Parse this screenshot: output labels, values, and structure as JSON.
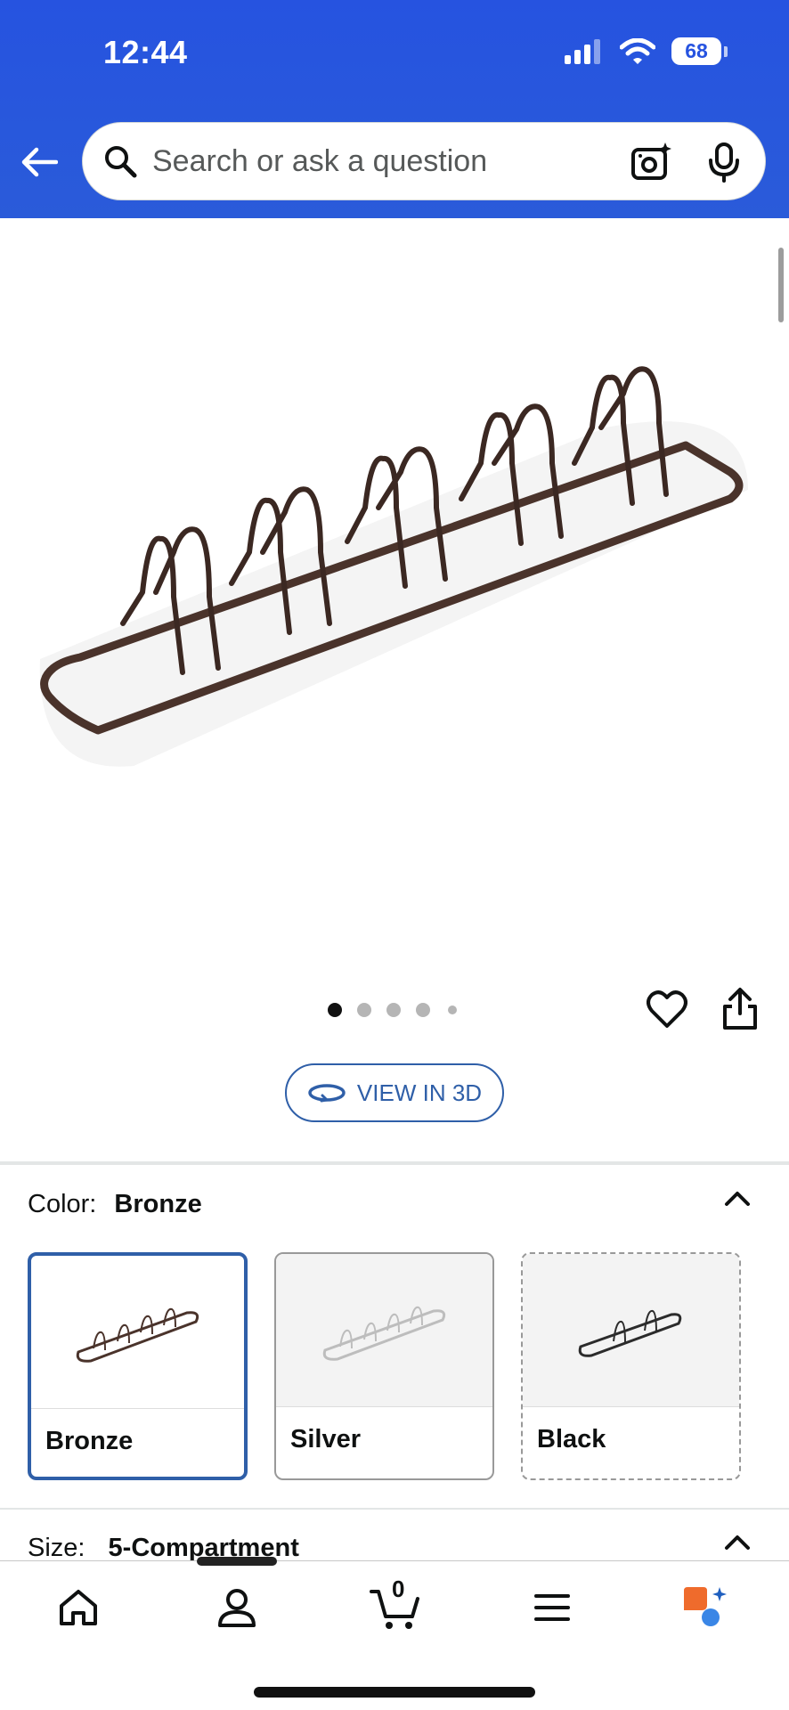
{
  "status_bar": {
    "time": "12:44",
    "battery": "68"
  },
  "search": {
    "placeholder": "Search or ask a question"
  },
  "gallery": {
    "image_count": 5,
    "active_index": 0
  },
  "view_3d_label": "VIEW IN 3D",
  "color": {
    "label": "Color:",
    "value": "Bronze",
    "options": [
      {
        "name": "Bronze",
        "state": "selected",
        "frame_color": "#5a3b2e"
      },
      {
        "name": "Silver",
        "state": "available",
        "frame_color": "#c8c8c8"
      },
      {
        "name": "Black",
        "state": "unavailable",
        "frame_color": "#2b2b2b"
      }
    ]
  },
  "size": {
    "label": "Size:",
    "value": "5-Compartment"
  },
  "bottom_nav": {
    "cart_count": "0"
  },
  "colors": {
    "header_blue": "#2653e0",
    "accent_blue": "#2f5fa8",
    "bronze": "#4a332b"
  }
}
